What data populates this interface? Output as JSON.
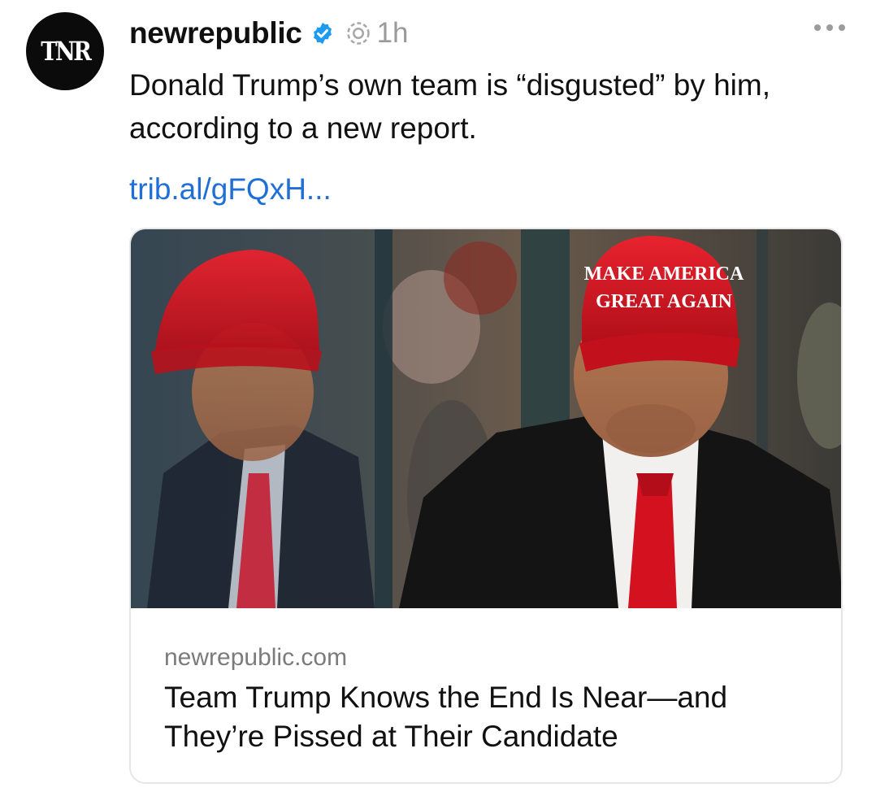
{
  "post": {
    "avatar_text": "TNR",
    "username": "newrepublic",
    "time": "1h",
    "text": "Donald Trump’s own team is “disgusted” by him, according to a new report.",
    "link": "trib.al/gFQxH..."
  },
  "card": {
    "hat_text_line1": "MAKE AMERICA",
    "hat_text_line2": "GREAT AGAIN",
    "domain": "newrepublic.com",
    "title": "Team Trump Knows the End Is Near—and They’re Pissed at Their Candidate"
  },
  "icons": {
    "verified": "verified-badge-icon",
    "ai": "ai-label-icon",
    "more": "more-options-icon"
  },
  "colors": {
    "link": "#1f6fd6",
    "verified": "#1d9bf0",
    "hat_red": "#d01622"
  }
}
